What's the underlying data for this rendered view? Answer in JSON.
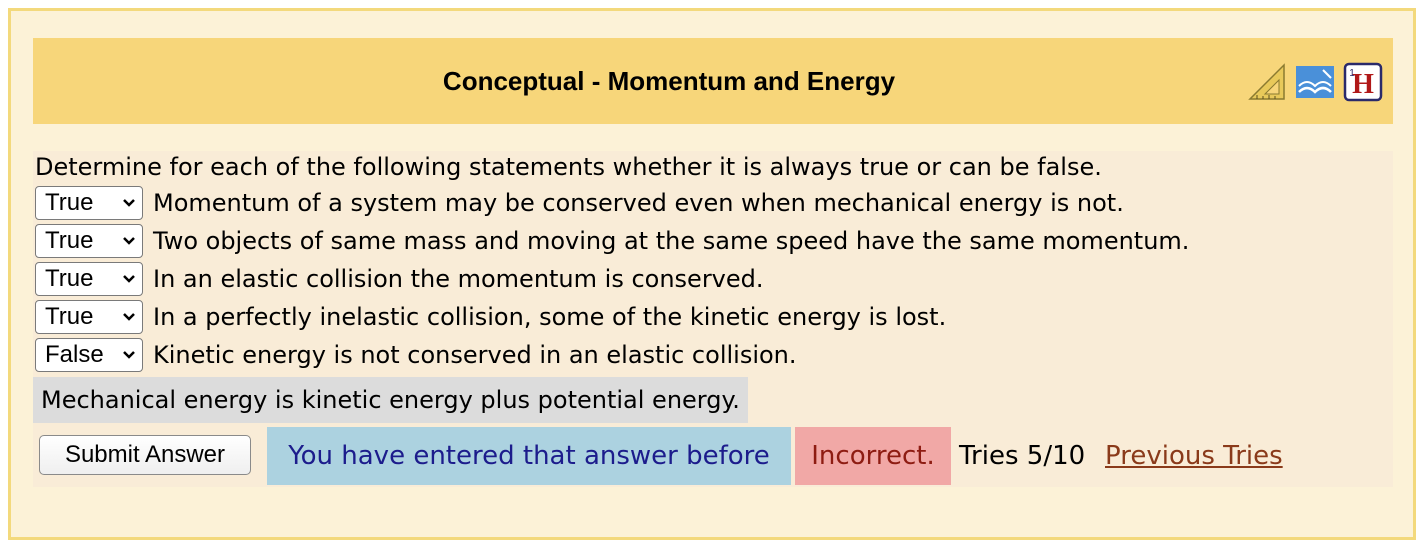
{
  "problem": {
    "title": "Conceptual - Momentum and Energy",
    "icons": [
      "ruler-triangle-icon",
      "open-book-icon",
      "help-h-icon"
    ],
    "prompt": "Determine for each of the following statements whether it is always true or can be false.",
    "statements": [
      {
        "selected": "True",
        "text": "Momentum of a system may be conserved even when mechanical energy is not."
      },
      {
        "selected": "True",
        "text": "Two objects of same mass and moving at the same speed have the same momentum."
      },
      {
        "selected": "True",
        "text": "In an elastic collision the momentum is conserved."
      },
      {
        "selected": "True",
        "text": "In a perfectly inelastic collision, some of the kinetic energy is lost."
      },
      {
        "selected": "False",
        "text": "Kinetic energy is not conserved in an elastic collision."
      }
    ],
    "hint": "Mechanical energy is kinetic energy plus potential energy."
  },
  "footer": {
    "submit_label": "Submit Answer",
    "previous_message": "You have entered that answer before",
    "result": "Incorrect.",
    "tries": "Tries 5/10",
    "previous_tries_link": "Previous Tries"
  },
  "colors": {
    "panel_background": "#fcf2d7",
    "header_background": "#f7d67a",
    "content_background": "#f9ecd7",
    "previous_message_background": "#acd2e0",
    "incorrect_background": "#f1a8a6",
    "link_color": "#8a3a1a"
  }
}
